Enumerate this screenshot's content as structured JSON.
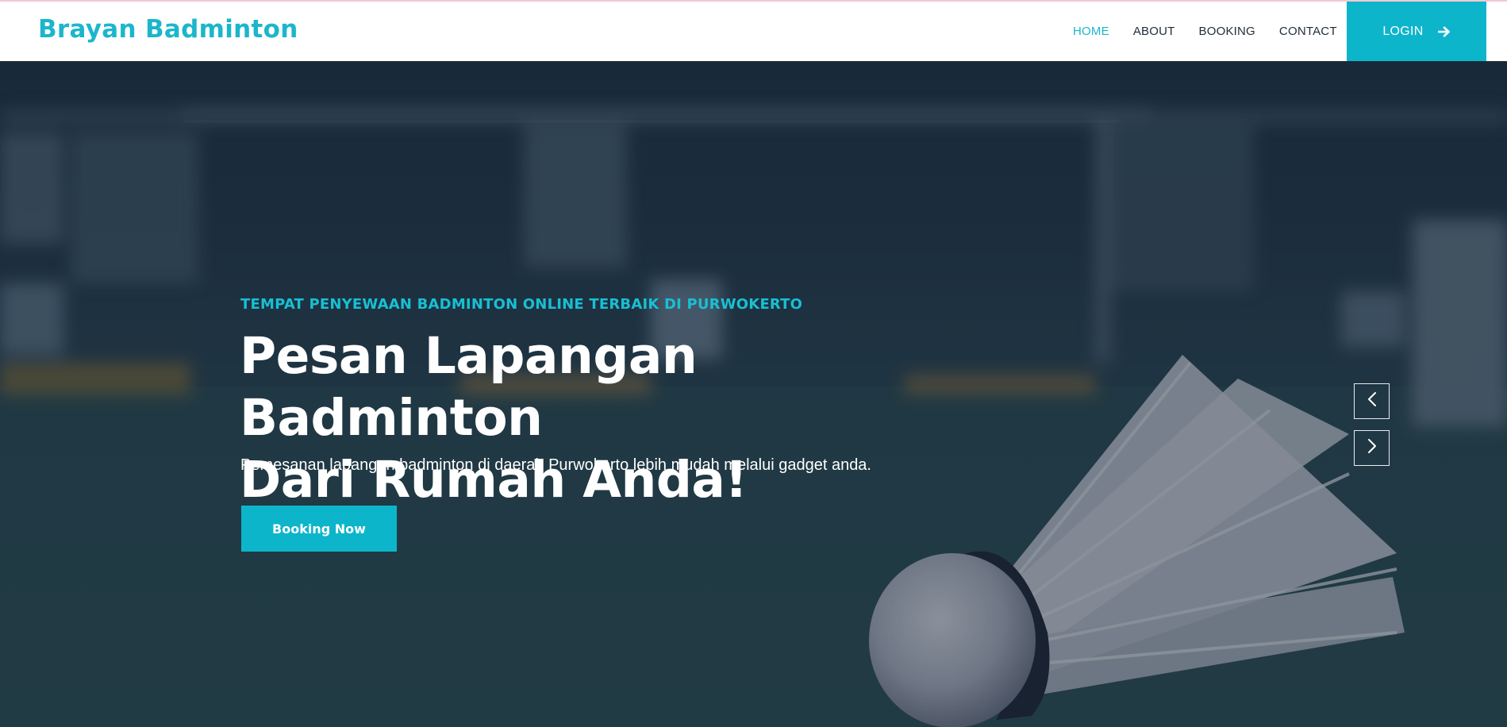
{
  "brand": {
    "name": "Brayan Badminton"
  },
  "nav": {
    "items": [
      {
        "label": "HOME",
        "active": true
      },
      {
        "label": "ABOUT",
        "active": false
      },
      {
        "label": "BOOKING",
        "active": false
      },
      {
        "label": "CONTACT",
        "active": false
      }
    ],
    "login_label": "LOGIN"
  },
  "hero": {
    "eyebrow": "TEMPAT PENYEWAAN BADMINTON ONLINE TERBAIK DI PURWOKERTO",
    "headline_line1": "Pesan Lapangan Badminton",
    "headline_line2": "Dari Rumah Anda!",
    "subtext": "Pemesanan lapangan badminton di daerah Purwokerto lebih mudah melalui gadget anda.",
    "cta_label": "Booking Now"
  },
  "icons": {
    "login": "arrow-right-icon",
    "prev": "chevron-left-icon",
    "next": "chevron-right-icon"
  },
  "colors": {
    "accent": "#0db5cb",
    "nav_text": "#1f2b3a",
    "hero_text": "#ffffff"
  }
}
